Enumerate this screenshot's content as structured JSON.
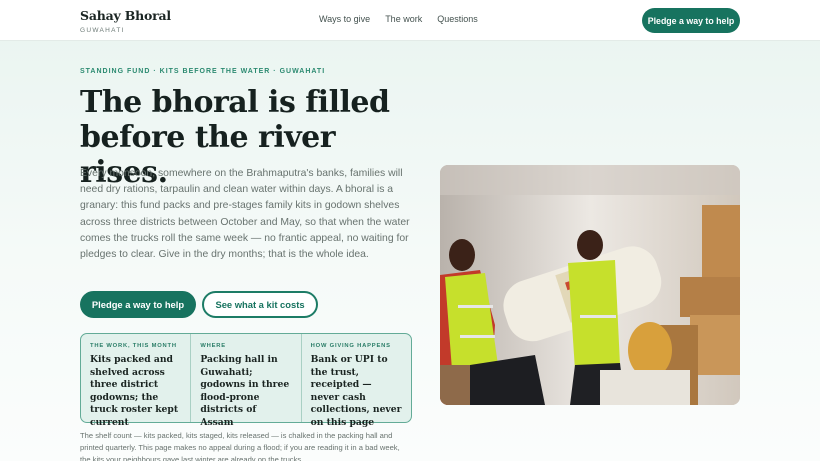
{
  "header": {
    "brand_name": "Sahay Bhoral",
    "brand_city": "GUWAHATI",
    "nav": [
      "Ways to give",
      "The work",
      "Questions"
    ],
    "cta": "Pledge a way to help"
  },
  "hero": {
    "eyebrow": "STANDING FUND · KITS BEFORE THE WATER · GUWAHATI",
    "headline": "The bhoral is filled before the river rises.",
    "lede": "Every monsoon, somewhere on the Brahmaputra's banks, families will need dry rations, tarpaulin and clean water within days. A bhoral is a granary: this fund packs and pre-stages family kits in godown shelves across three districts between October and May, so that when the water comes the trucks roll the same week — no frantic appeal, no waiting for pledges to clear. Give in the dry months; that is the whole idea.",
    "primary_cta": "Pledge a way to help",
    "secondary_cta": "See what a kit costs"
  },
  "facts": [
    {
      "label": "THE WORK, THIS MONTH",
      "value": "Kits packed and shelved across three district godowns; the truck roster kept current"
    },
    {
      "label": "WHERE",
      "value": "Packing hall in Guwahati; godowns in three flood-prone districts of Assam"
    },
    {
      "label": "HOW GIVING HAPPENS",
      "value": "Bank or UPI to the trust, receipted — never cash collections, never on this page"
    }
  ],
  "footnote": "The shelf count — kits packed, kits staged, kits released — is chalked in the packing hall and printed quarterly. This page makes no appeal during a flood; if you are reading it in a bad week, the kits your neighbours gave last winter are already on the trucks.",
  "colors": {
    "accent": "#17735f",
    "accent_light": "#e2f1ec",
    "vest": "#c6e02c"
  }
}
